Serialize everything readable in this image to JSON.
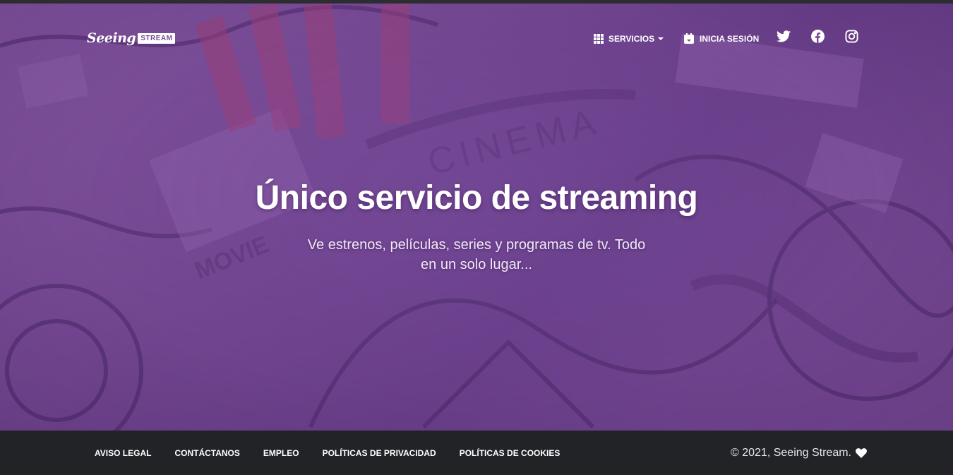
{
  "brand": {
    "logo_script": "Seeing",
    "logo_box": "STREAM"
  },
  "nav": {
    "services_label": "SERVICIOS",
    "login_label": "INICIA SESIÓN"
  },
  "hero": {
    "title": "Único servicio de streaming",
    "subtitle": "Ve estrenos, películas, series y programas de tv. Todo en un solo lugar...",
    "bg_words": [
      "CINEMA",
      "MOVIE"
    ]
  },
  "footer": {
    "links": [
      "AVISO LEGAL",
      "CONTÁCTANOS",
      "EMPLEO",
      "POLÍTICAS DE PRIVACIDAD",
      "POLÍTICAS DE COOKIES"
    ],
    "copyright": "© 2021, Seeing Stream."
  },
  "icons": {
    "services": "grid-icon",
    "login": "calendar-icon",
    "social": [
      "twitter-icon",
      "facebook-icon",
      "instagram-icon"
    ],
    "footer": "heart-icon"
  },
  "colors": {
    "hero_purple": "#7a4c98",
    "footer_bg": "#212327",
    "text": "#ffffff"
  }
}
